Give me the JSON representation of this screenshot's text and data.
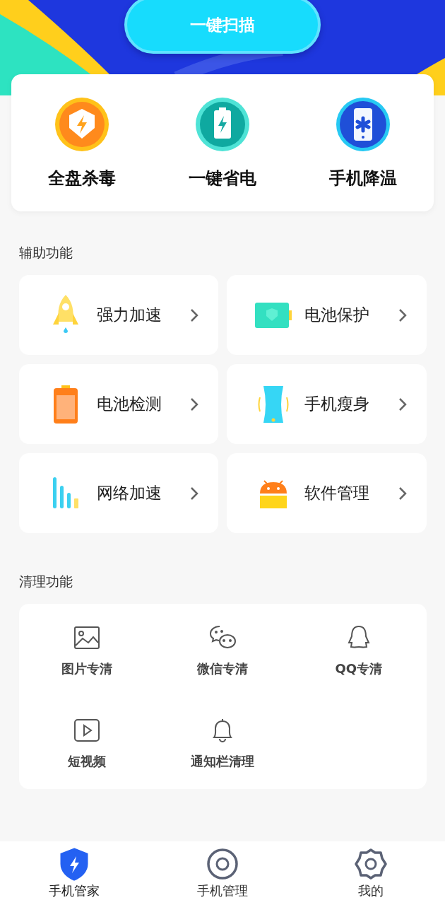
{
  "scan_button": "一键扫描",
  "features": [
    {
      "label": "全盘杀毒",
      "kind": "shield"
    },
    {
      "label": "一键省电",
      "kind": "battery"
    },
    {
      "label": "手机降温",
      "kind": "phone"
    }
  ],
  "tools_section": {
    "title": "辅助功能",
    "items": [
      {
        "label": "强力加速",
        "kind": "rocket"
      },
      {
        "label": "电池保护",
        "kind": "battery-guard"
      },
      {
        "label": "电池检测",
        "kind": "battery-check"
      },
      {
        "label": "手机瘦身",
        "kind": "slim"
      },
      {
        "label": "网络加速",
        "kind": "bars"
      },
      {
        "label": "软件管理",
        "kind": "android"
      }
    ]
  },
  "clean_section": {
    "title": "清理功能",
    "items": [
      {
        "label": "图片专清",
        "kind": "image"
      },
      {
        "label": "微信专清",
        "kind": "chat"
      },
      {
        "label": "QQ专清",
        "kind": "penguin"
      },
      {
        "label": "短视频",
        "kind": "video"
      },
      {
        "label": "通知栏清理",
        "kind": "bell"
      }
    ]
  },
  "nav": [
    {
      "label": "手机管家",
      "kind": "shield",
      "selected": true
    },
    {
      "label": "手机管理",
      "kind": "ring",
      "selected": false
    },
    {
      "label": "我的",
      "kind": "gear",
      "selected": false
    }
  ]
}
